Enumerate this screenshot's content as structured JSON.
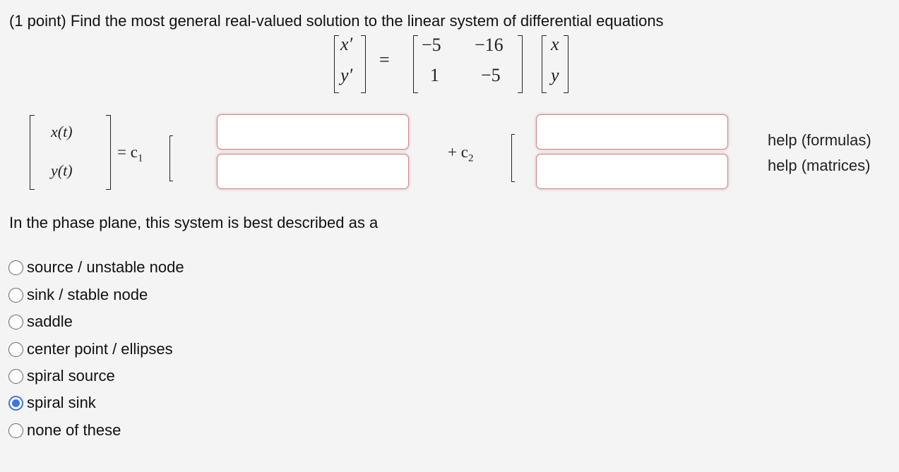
{
  "problem": {
    "prompt": "(1 point) Find the most general real-valued solution to the linear system of differential equations",
    "system": {
      "lhs": [
        "x′",
        "y′"
      ],
      "equals": "=",
      "matrix": [
        [
          "−5",
          "−16"
        ],
        [
          "1",
          "−5"
        ]
      ],
      "vector": [
        "x",
        "y"
      ]
    },
    "solution": {
      "lhs": [
        "x(t)",
        "y(t)"
      ],
      "equals_c1": "= c",
      "c1_sub": "1",
      "plus_c2": "+ c",
      "c2_sub": "2",
      "c1_fields": [
        {
          "value": ""
        },
        {
          "value": ""
        }
      ],
      "c2_fields": [
        {
          "value": ""
        },
        {
          "value": ""
        }
      ]
    },
    "help_links": [
      "help (formulas)",
      "help (matrices)"
    ],
    "phase_question": "In the phase plane, this system is best described as a",
    "options": [
      {
        "label": "source / unstable node",
        "checked": false
      },
      {
        "label": "sink / stable node",
        "checked": false
      },
      {
        "label": "saddle",
        "checked": false
      },
      {
        "label": "center point / ellipses",
        "checked": false
      },
      {
        "label": "spiral source",
        "checked": false
      },
      {
        "label": "spiral sink",
        "checked": true
      },
      {
        "label": "none of these",
        "checked": false
      }
    ],
    "accent_color": "#3b73ee",
    "field_border_color": "#c98686"
  }
}
